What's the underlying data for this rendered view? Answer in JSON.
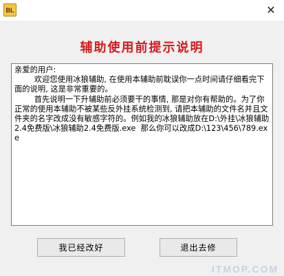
{
  "window": {
    "app_icon_text": "BL",
    "close_glyph": "✕"
  },
  "heading": "辅助使用前提示说明",
  "notice_text": "亲爱的用户:\n        欢迎您使用冰狼辅助, 在使用本辅助前耽误你一点时间请仔细看完下面的说明, 这是非常重要的。\n        首先说明一下升辅助前必须要干的事情, 那是对你有帮助的。为了你正常的使用本辅助不被某些反外挂系统检测到, 请把本辅助的文件名并且文件夹的名字改成没有敏感字符的。例如我的冰狼辅助放在D:\\外挂\\冰狼辅助2.4免费版\\冰狼辅助2.4免费版.exe  那么你可以改成D:\\123\\456\\789.exe",
  "buttons": {
    "ok_label": "我已经改好",
    "exit_label": "退出去修"
  },
  "watermark": "ITMOP.COM"
}
